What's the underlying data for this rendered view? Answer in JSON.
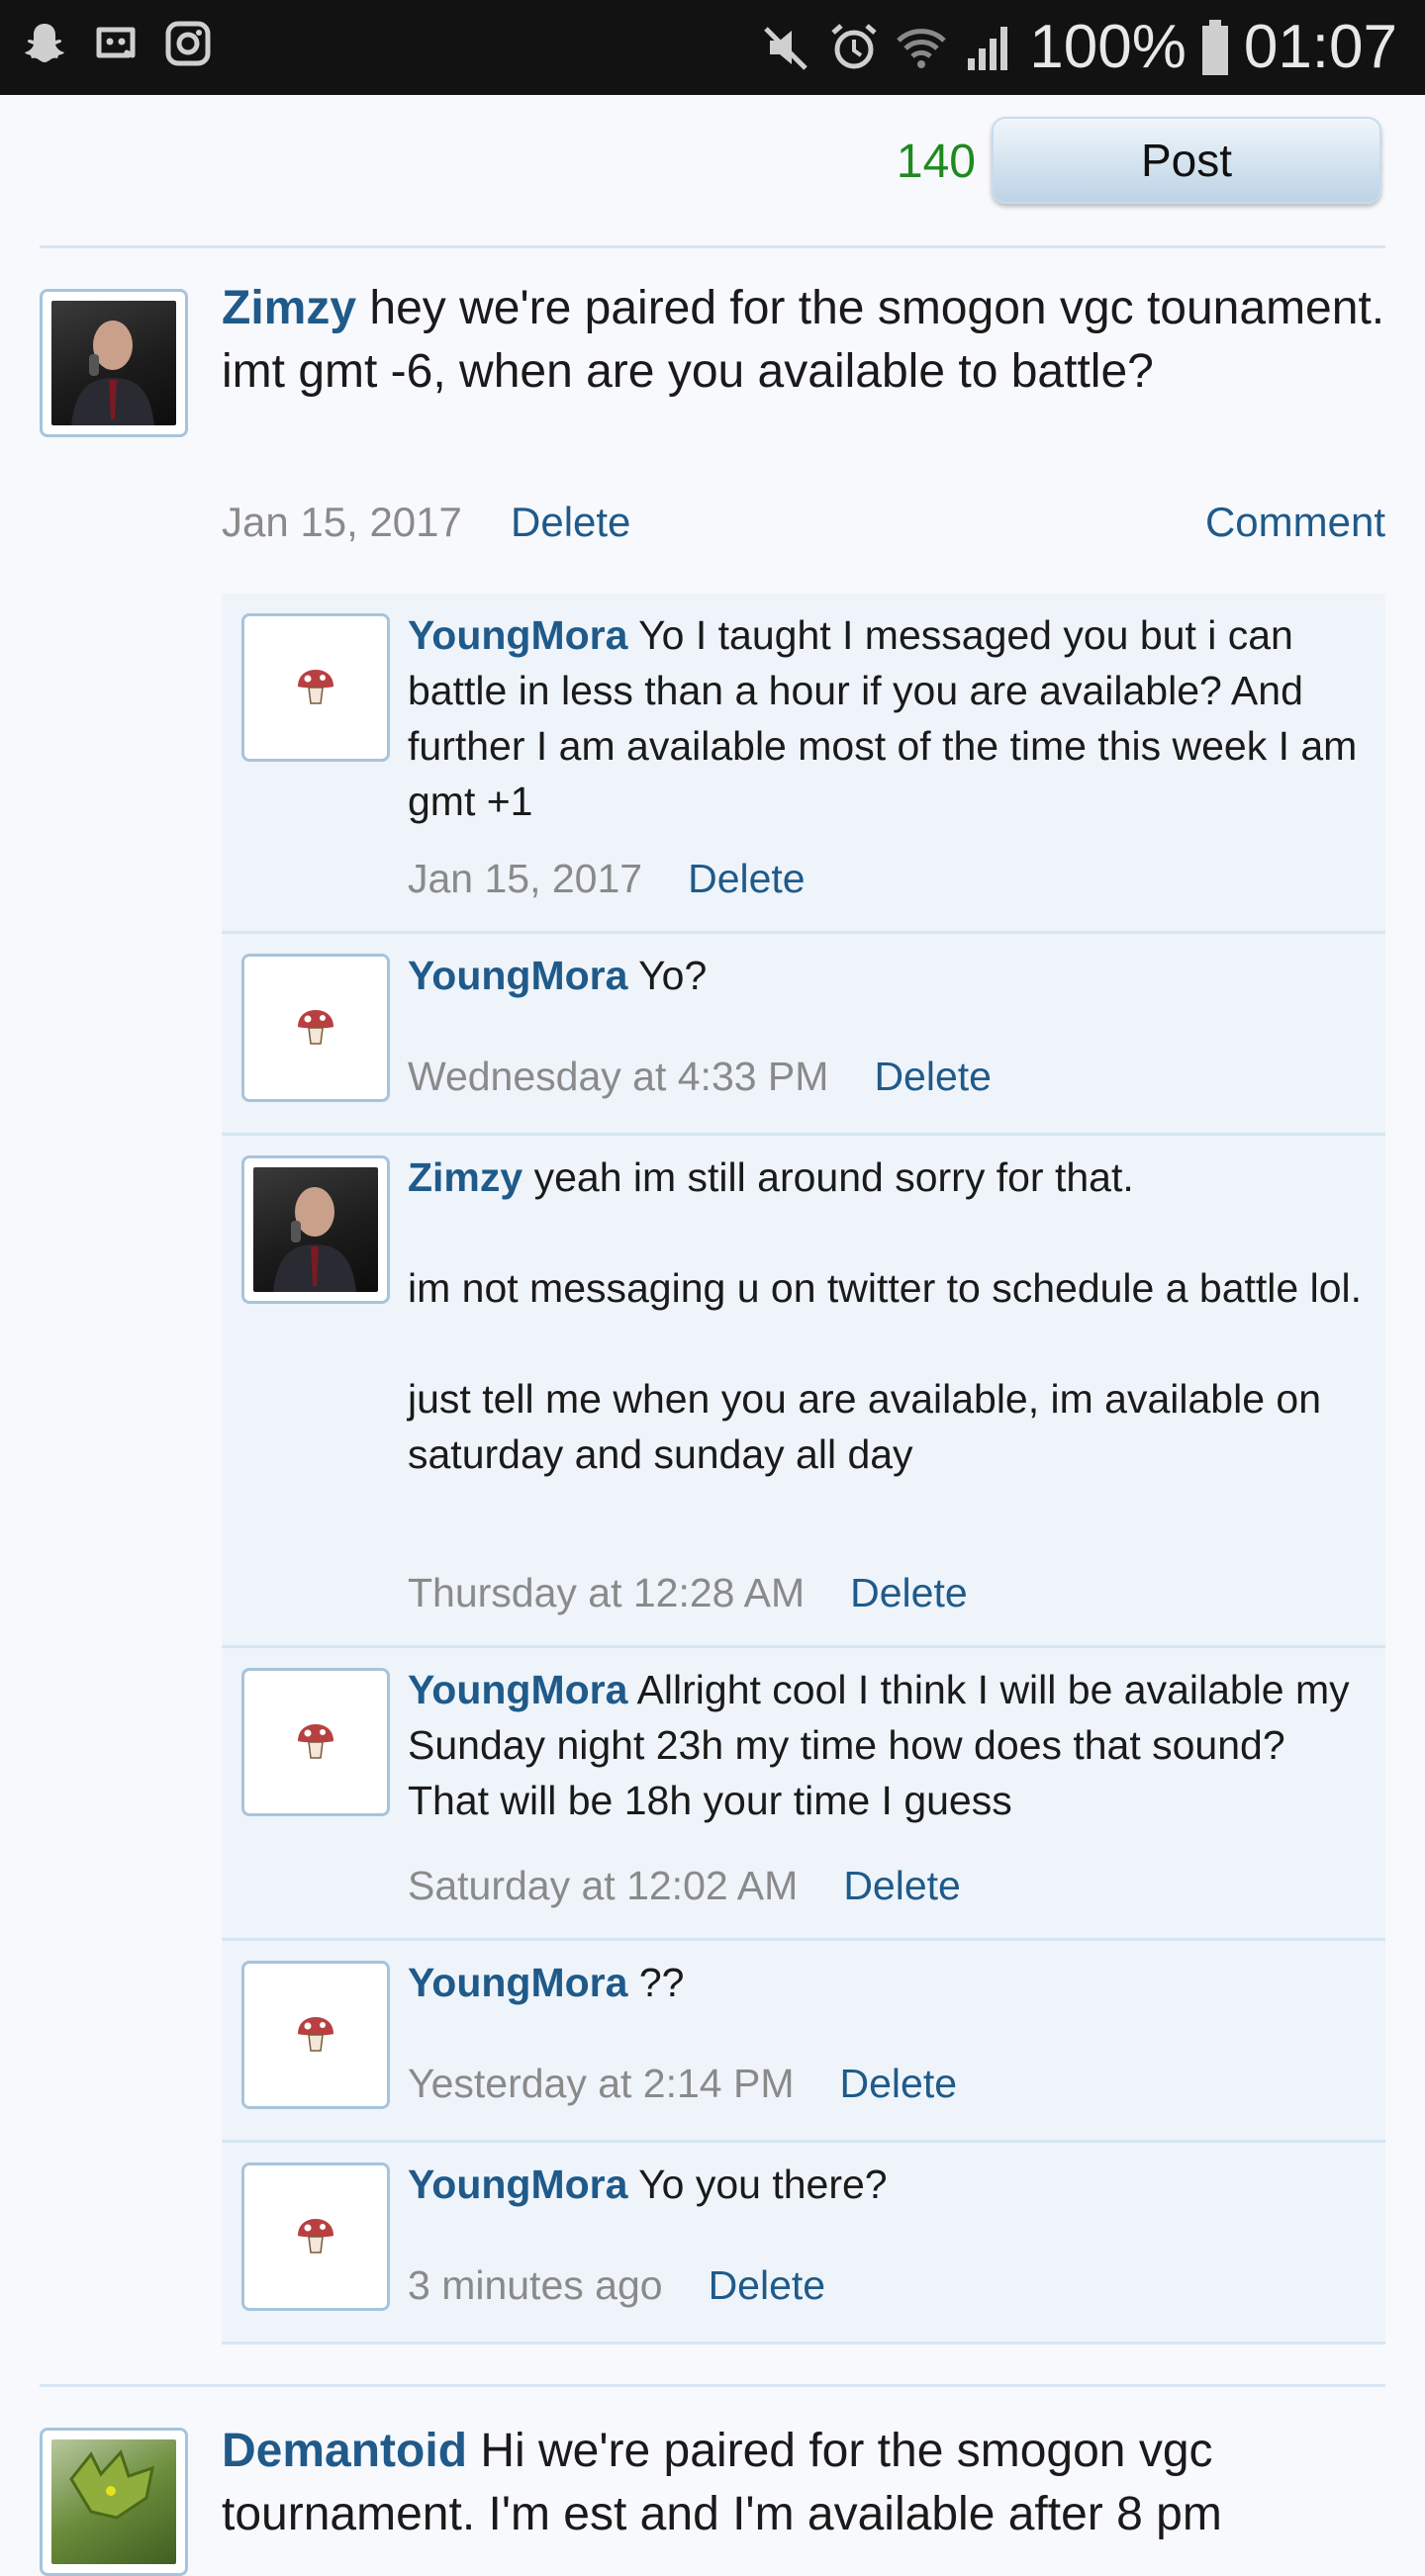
{
  "status_bar": {
    "battery": "100%",
    "time": "01:07"
  },
  "composer": {
    "char_count": "140",
    "post_label": "Post"
  },
  "main_post": {
    "user": "Zimzy",
    "text": " hey we're paired for the smogon vgc tounament. imt gmt -6, when are you available to battle?",
    "date": "Jan 15, 2017",
    "delete_label": "Delete",
    "comment_label": "Comment"
  },
  "comments": [
    {
      "user": "YoungMora",
      "text": " Yo I taught I messaged you but i can battle in less than a hour if you are available? And further I am available most of the time this week I am gmt +1",
      "date": "Jan 15, 2017",
      "delete_label": "Delete"
    },
    {
      "user": "YoungMora",
      "text": " Yo?",
      "date": "Wednesday at 4:33 PM",
      "delete_label": "Delete"
    },
    {
      "user": "Zimzy",
      "text": " yeah im still around sorry for that.\n\nim not messaging u on twitter to schedule a battle lol.\n\njust tell me when you are available, im available on saturday and sunday all day",
      "date": "Thursday at 12:28 AM",
      "delete_label": "Delete"
    },
    {
      "user": "YoungMora",
      "text": " Allright cool I think I will be available my Sunday night 23h my time how does that sound? That will be 18h your time I guess",
      "date": "Saturday at 12:02 AM",
      "delete_label": "Delete"
    },
    {
      "user": "YoungMora",
      "text": " ??",
      "date": "Yesterday at 2:14 PM",
      "delete_label": "Delete"
    },
    {
      "user": "YoungMora",
      "text": " Yo you there?",
      "date": "3 minutes ago",
      "delete_label": "Delete"
    }
  ],
  "next_post": {
    "user": "Demantoid",
    "text": " Hi we're paired for the smogon vgc tournament. I'm est and I'm available after 8 pm"
  }
}
